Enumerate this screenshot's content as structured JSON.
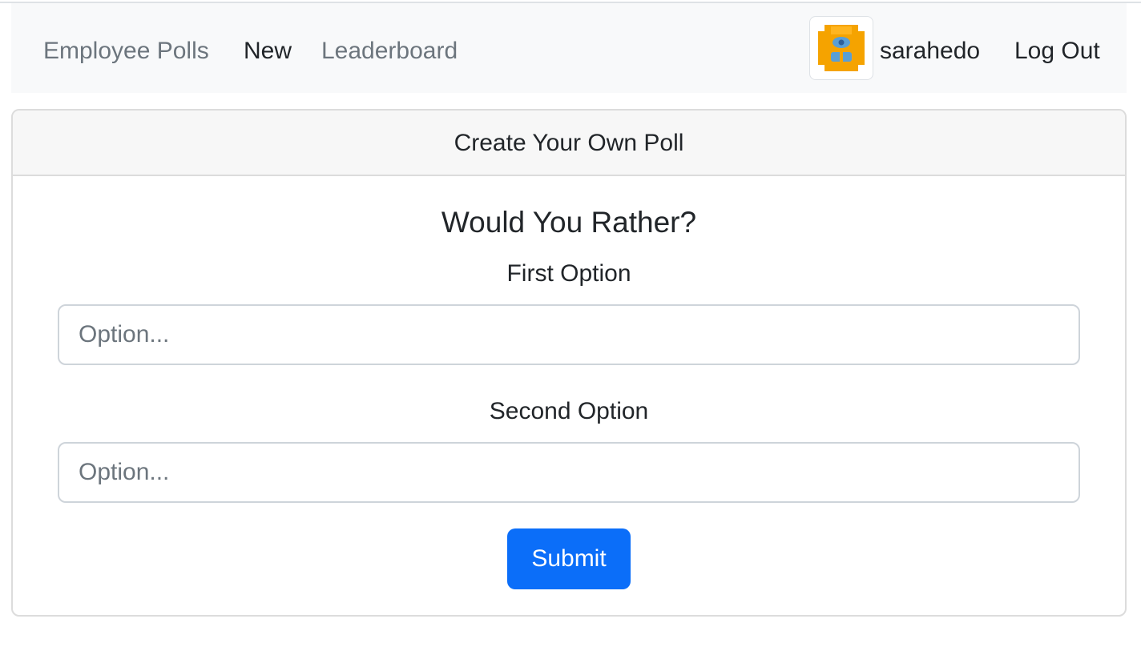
{
  "navbar": {
    "brand": "Employee Polls",
    "links": {
      "new": "New",
      "leaderboard": "Leaderboard"
    },
    "user": {
      "avatar_icon": "user-avatar-icon",
      "username": "sarahedo",
      "logout": "Log Out"
    }
  },
  "card": {
    "header": "Create Your Own Poll",
    "title": "Would You Rather?",
    "first_option": {
      "label": "First Option",
      "placeholder": "Option...",
      "value": ""
    },
    "second_option": {
      "label": "Second Option",
      "placeholder": "Option...",
      "value": ""
    },
    "submit_label": "Submit"
  },
  "colors": {
    "primary": "#0b6ef9",
    "navbar_bg": "#f8f9fa",
    "muted_text": "#6c757d",
    "avatar_orange": "#f5a300",
    "avatar_blue": "#5a9fd4"
  }
}
